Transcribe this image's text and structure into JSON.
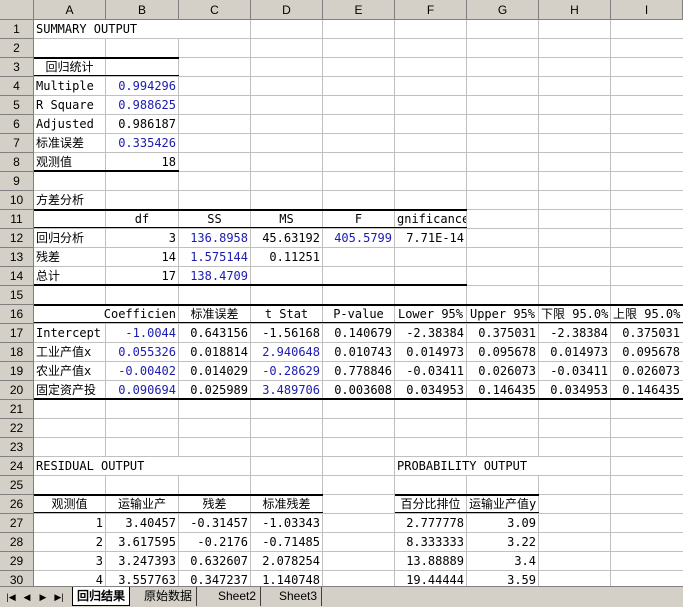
{
  "columns": [
    "A",
    "B",
    "C",
    "D",
    "E",
    "F",
    "G",
    "H",
    "I"
  ],
  "rows": [
    "1",
    "2",
    "3",
    "4",
    "5",
    "6",
    "7",
    "8",
    "9",
    "10",
    "11",
    "12",
    "13",
    "14",
    "15",
    "16",
    "17",
    "18",
    "19",
    "20",
    "21",
    "22",
    "23",
    "24",
    "25",
    "26",
    "27",
    "28",
    "29",
    "30"
  ],
  "colors": {
    "blue_value": "#1b1bb0",
    "header_bg": "#d4d0c8",
    "grid": "#c0c0c0"
  },
  "cells": {
    "A1": "SUMMARY OUTPUT",
    "A3": "回归统计",
    "A4": "Multiple",
    "B4": "0.994296",
    "A5": "R Square",
    "B5": "0.988625",
    "A6": "Adjusted",
    "B6": "0.986187",
    "A7": "标准误差",
    "B7": "0.335426",
    "A8": "观测值",
    "B8": "18",
    "A10": "方差分析",
    "B11": "df",
    "C11": "SS",
    "D11": "MS",
    "E11": "F",
    "F11": "gnificance F",
    "A12": "回归分析",
    "B12": "3",
    "C12": "136.8958",
    "D12": "45.63192",
    "E12": "405.5799",
    "F12": "7.71E-14",
    "A13": "残差",
    "B13": "14",
    "C13": "1.575144",
    "D13": "0.11251",
    "A14": "总计",
    "B14": "17",
    "C14": "138.4709",
    "A16": "Coefficien",
    "C16": "标准误差",
    "D16": "t Stat",
    "E16": "P-value",
    "F16": "Lower 95%",
    "G16": "Upper 95%",
    "H16": "下限 95.0%",
    "I16": "上限 95.0%",
    "A17": "Intercept",
    "B17": "-1.0044",
    "C17": "0.643156",
    "D17": "-1.56168",
    "E17": "0.140679",
    "F17": "-2.38384",
    "G17": "0.375031",
    "H17": "-2.38384",
    "I17": "0.375031",
    "A18": "工业产值x",
    "B18": "0.055326",
    "C18": "0.018814",
    "D18": "2.940648",
    "E18": "0.010743",
    "F18": "0.014973",
    "G18": "0.095678",
    "H18": "0.014973",
    "I18": "0.095678",
    "A19": "农业产值x",
    "B19": "-0.00402",
    "C19": "0.014029",
    "D19": "-0.28629",
    "E19": "0.778846",
    "F19": "-0.03411",
    "G19": "0.026073",
    "H19": "-0.03411",
    "I19": "0.026073",
    "A20": "固定资产投",
    "B20": "0.090694",
    "C20": "0.025989",
    "D20": "3.489706",
    "E20": "0.003608",
    "F20": "0.034953",
    "G20": "0.146435",
    "H20": "0.034953",
    "I20": "0.146435",
    "A24": "RESIDUAL OUTPUT",
    "F24": "PROBABILITY OUTPUT",
    "A26": "观测值",
    "B26": "运输业产",
    "C26": "残差",
    "D26": "标准残差",
    "F26": "百分比排位",
    "G26": "运输业产值y",
    "A27": "1",
    "B27": "3.40457",
    "C27": "-0.31457",
    "D27": "-1.03343",
    "F27": "2.777778",
    "G27": "3.09",
    "A28": "2",
    "B28": "3.617595",
    "C28": "-0.2176",
    "D28": "-0.71485",
    "F28": "8.333333",
    "G28": "3.22",
    "A29": "3",
    "B29": "3.247393",
    "C29": "0.632607",
    "D29": "2.078254",
    "F29": "13.88889",
    "G29": "3.4",
    "A30": "4",
    "B30": "3.557763",
    "C30": "0.347237",
    "D30": "1.140748",
    "F30": "19.44444",
    "G30": "3.59"
  },
  "tabs": [
    "回归结果",
    "原始数据",
    "Sheet2",
    "Sheet3"
  ],
  "nav_icons": [
    "first-sheet-icon",
    "prev-sheet-icon",
    "next-sheet-icon",
    "last-sheet-icon"
  ]
}
